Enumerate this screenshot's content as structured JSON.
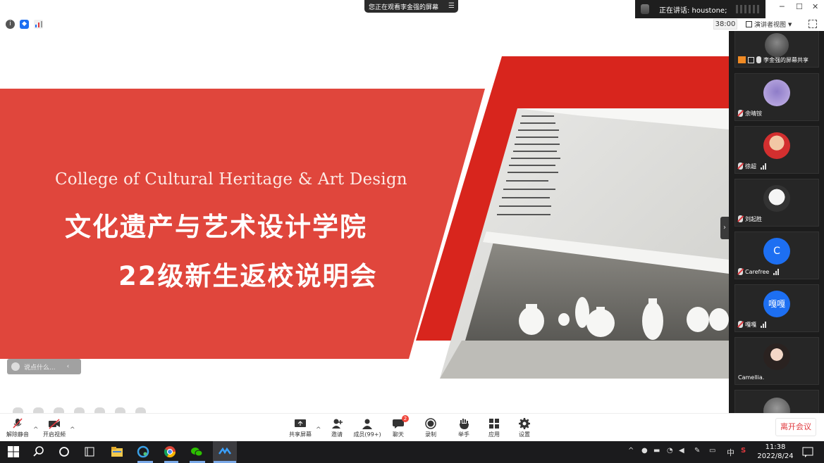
{
  "banner": {
    "sharing_text": "您正在观看李金强的屏幕"
  },
  "speaking": {
    "label": "正在讲话: houstone;"
  },
  "toolbar": {
    "timer": "38:00",
    "view_label": "演讲者视图"
  },
  "slide": {
    "title_en": "College of Cultural Heritage & Art Design",
    "title_cn_1": "文化遗产与艺术设计学院",
    "title_cn_2": "22级新生返校说明会"
  },
  "chat_input": {
    "placeholder": "说点什么..."
  },
  "participants": [
    {
      "name": "李金强的屏幕共享",
      "muted": false
    },
    {
      "name": "余晴铵",
      "muted": true
    },
    {
      "name": "徐超",
      "muted": true
    },
    {
      "name": "刘起胜",
      "muted": true
    },
    {
      "name": "Carefree",
      "muted": true,
      "initial": "C"
    },
    {
      "name": "嘎嘎",
      "muted": true,
      "initial": "嘎嘎"
    },
    {
      "name": "Camellia.",
      "muted": false
    }
  ],
  "controls": {
    "unmute": "解除静音",
    "start_video": "开启视频",
    "share_screen": "共享屏幕",
    "invite": "邀请",
    "members": "成员(99+)",
    "chat": "聊天",
    "chat_badge": "2",
    "record": "录制",
    "raise_hand": "举手",
    "apps": "应用",
    "settings": "设置",
    "leave": "离开会议"
  },
  "taskbar": {
    "ime_lang": "中",
    "time": "11:38",
    "date": "2022/8/24"
  },
  "colors": {
    "slide_red": "#e0463c",
    "deep_red": "#d8251d",
    "zoom_blue": "#1d6ff2",
    "leave_red": "#e0393e"
  }
}
